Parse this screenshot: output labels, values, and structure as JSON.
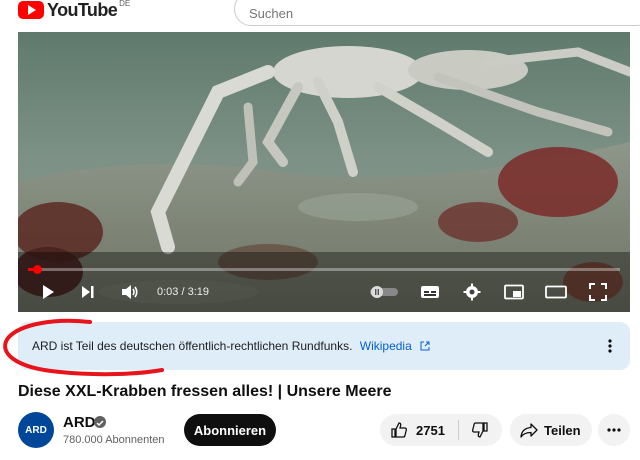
{
  "header": {
    "logo_text": "YouTube",
    "region": "DE",
    "search_placeholder": "Suchen"
  },
  "player": {
    "current_time": "0:03",
    "duration": "3:19",
    "time_display": "0:03 / 3:19",
    "progress_fraction": 0.015,
    "icons": [
      "play-icon",
      "next-icon",
      "volume-icon",
      "autoplay-toggle-icon",
      "subtitles-icon",
      "settings-icon",
      "miniplayer-icon",
      "theater-icon",
      "fullscreen-icon"
    ]
  },
  "info_panel": {
    "text": "ARD ist Teil des deutschen öffentlich-rechtlichen Rundfunks.",
    "link_label": "Wikipedia"
  },
  "video": {
    "title": "Diese XXL-Krabben fressen alles! | Unsere Meere"
  },
  "channel": {
    "avatar_text": "ARD",
    "name": "ARD",
    "subscribers": "780.000 Abonnenten",
    "subscribe_label": "Abonnieren"
  },
  "actions": {
    "like_count": "2751",
    "share_label": "Teilen"
  },
  "colors": {
    "brand_red": "#ff0000",
    "banner_bg": "#deedf8",
    "link_blue": "#065fd4",
    "annotation_red": "#e8141c"
  }
}
